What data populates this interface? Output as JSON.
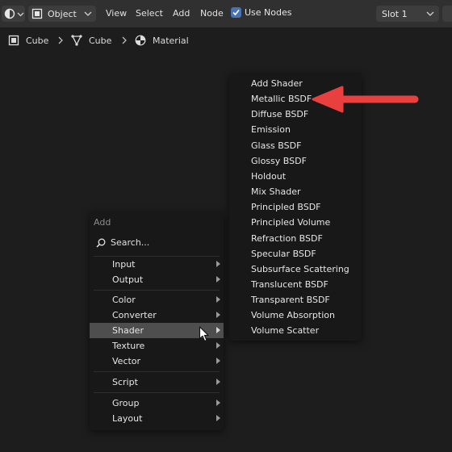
{
  "header": {
    "editor_type_icon": "node-editor-icon",
    "mode": {
      "label": "Object",
      "icon": "object-mode-icon"
    },
    "menus": [
      "View",
      "Select",
      "Add",
      "Node"
    ],
    "use_nodes": {
      "label": "Use Nodes",
      "checked": true
    },
    "slot": {
      "label": "Slot 1"
    }
  },
  "breadcrumb": [
    {
      "label": "Cube",
      "icon": "object-icon"
    },
    {
      "label": "Cube",
      "icon": "mesh-icon"
    },
    {
      "label": "Material",
      "icon": "material-icon"
    }
  ],
  "add_menu": {
    "title": "Add",
    "search_placeholder": "Search...",
    "groups": [
      [
        {
          "label": "Input",
          "submenu": true
        },
        {
          "label": "Output",
          "submenu": true
        }
      ],
      [
        {
          "label": "Color",
          "submenu": true
        },
        {
          "label": "Converter",
          "submenu": true
        },
        {
          "label": "Shader",
          "submenu": true,
          "active": true
        },
        {
          "label": "Texture",
          "submenu": true
        },
        {
          "label": "Vector",
          "submenu": true
        }
      ],
      [
        {
          "label": "Script",
          "submenu": true
        }
      ],
      [
        {
          "label": "Group",
          "submenu": true
        },
        {
          "label": "Layout",
          "submenu": true
        }
      ]
    ]
  },
  "shader_menu": {
    "items": [
      "Add Shader",
      "Metallic BSDF",
      "Diffuse BSDF",
      "Emission",
      "Glass BSDF",
      "Glossy BSDF",
      "Holdout",
      "Mix Shader",
      "Principled BSDF",
      "Principled Volume",
      "Refraction BSDF",
      "Specular BSDF",
      "Subsurface Scattering",
      "Translucent BSDF",
      "Transparent BSDF",
      "Volume Absorption",
      "Volume Scatter"
    ],
    "highlighted": "Metallic BSDF"
  },
  "colors": {
    "background": "#1d1d1d",
    "header": "#303030",
    "menu_bg": "#181818",
    "active_row": "#4e4e4e",
    "checkbox": "#4772b3",
    "annotation_arrow": "#e8403f"
  }
}
